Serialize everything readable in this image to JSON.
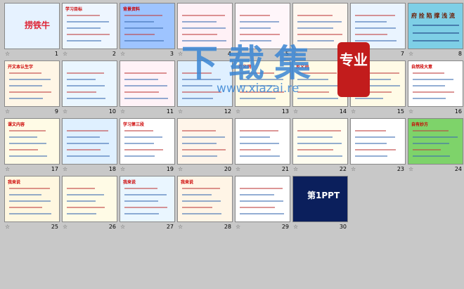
{
  "slides": [
    {
      "n": "1",
      "kind": "cover",
      "title": "捞铁牛",
      "bg": "#e6f2ff"
    },
    {
      "n": "2",
      "kind": "text",
      "title": "学习目标",
      "bg": "#eef6ff"
    },
    {
      "n": "3",
      "kind": "text",
      "title": "背景资料",
      "bg": "#9ec4ff"
    },
    {
      "n": "4",
      "kind": "text",
      "title": "",
      "bg": "#fff1f6"
    },
    {
      "n": "5",
      "kind": "text",
      "title": "",
      "bg": "#fff6fa"
    },
    {
      "n": "6",
      "kind": "text",
      "title": "",
      "bg": "#fff7f0"
    },
    {
      "n": "7",
      "kind": "text",
      "title": "",
      "bg": "#eaf4ff"
    },
    {
      "n": "8",
      "kind": "chars",
      "title": "府 拴 陷 撑 浅 流",
      "bg": "#7ecfe6"
    },
    {
      "n": "9",
      "kind": "text",
      "title": "开文本认生字",
      "bg": "#fff6e6"
    },
    {
      "n": "10",
      "kind": "text",
      "title": "",
      "bg": "#eaf6ff"
    },
    {
      "n": "11",
      "kind": "text",
      "title": "",
      "bg": "#fff2f7"
    },
    {
      "n": "12",
      "kind": "text",
      "title": "",
      "bg": "#dff0ff"
    },
    {
      "n": "13",
      "kind": "text",
      "title": "近义词",
      "bg": "#fffbe6"
    },
    {
      "n": "14",
      "kind": "text",
      "title": "反义词",
      "bg": "#fffbe6"
    },
    {
      "n": "15",
      "kind": "text",
      "title": "",
      "bg": "#fffbe6"
    },
    {
      "n": "16",
      "kind": "text",
      "title": "自然段大意",
      "bg": "#ffffff"
    },
    {
      "n": "17",
      "kind": "text",
      "title": "课文内容",
      "bg": "#fffbe6"
    },
    {
      "n": "18",
      "kind": "text",
      "title": "",
      "bg": "#dff0ff"
    },
    {
      "n": "19",
      "kind": "text",
      "title": "学习第三段",
      "bg": "#ffffff"
    },
    {
      "n": "20",
      "kind": "text",
      "title": "",
      "bg": "#fff5ea"
    },
    {
      "n": "21",
      "kind": "text",
      "title": "",
      "bg": "#ffffff"
    },
    {
      "n": "22",
      "kind": "text",
      "title": "",
      "bg": "#fffdf0"
    },
    {
      "n": "23",
      "kind": "text",
      "title": "",
      "bg": "#ffffff"
    },
    {
      "n": "24",
      "kind": "text",
      "title": "自有妙方",
      "bg": "#7ed36a"
    },
    {
      "n": "25",
      "kind": "text",
      "title": "我来说",
      "bg": "#fff7e0"
    },
    {
      "n": "26",
      "kind": "text",
      "title": "",
      "bg": "#fffbe6"
    },
    {
      "n": "27",
      "kind": "text",
      "title": "我来说",
      "bg": "#eaf6ff"
    },
    {
      "n": "28",
      "kind": "text",
      "title": "我来说",
      "bg": "#fff5e6"
    },
    {
      "n": "29",
      "kind": "text",
      "title": "",
      "bg": "#ffffff"
    },
    {
      "n": "30",
      "kind": "brand",
      "title": "第1PPT",
      "bg": "#0b1f5c"
    }
  ],
  "star_glyph": "☆",
  "watermark": {
    "main": "下载集",
    "url": "www.xiazai.re",
    "badge": "专业"
  }
}
